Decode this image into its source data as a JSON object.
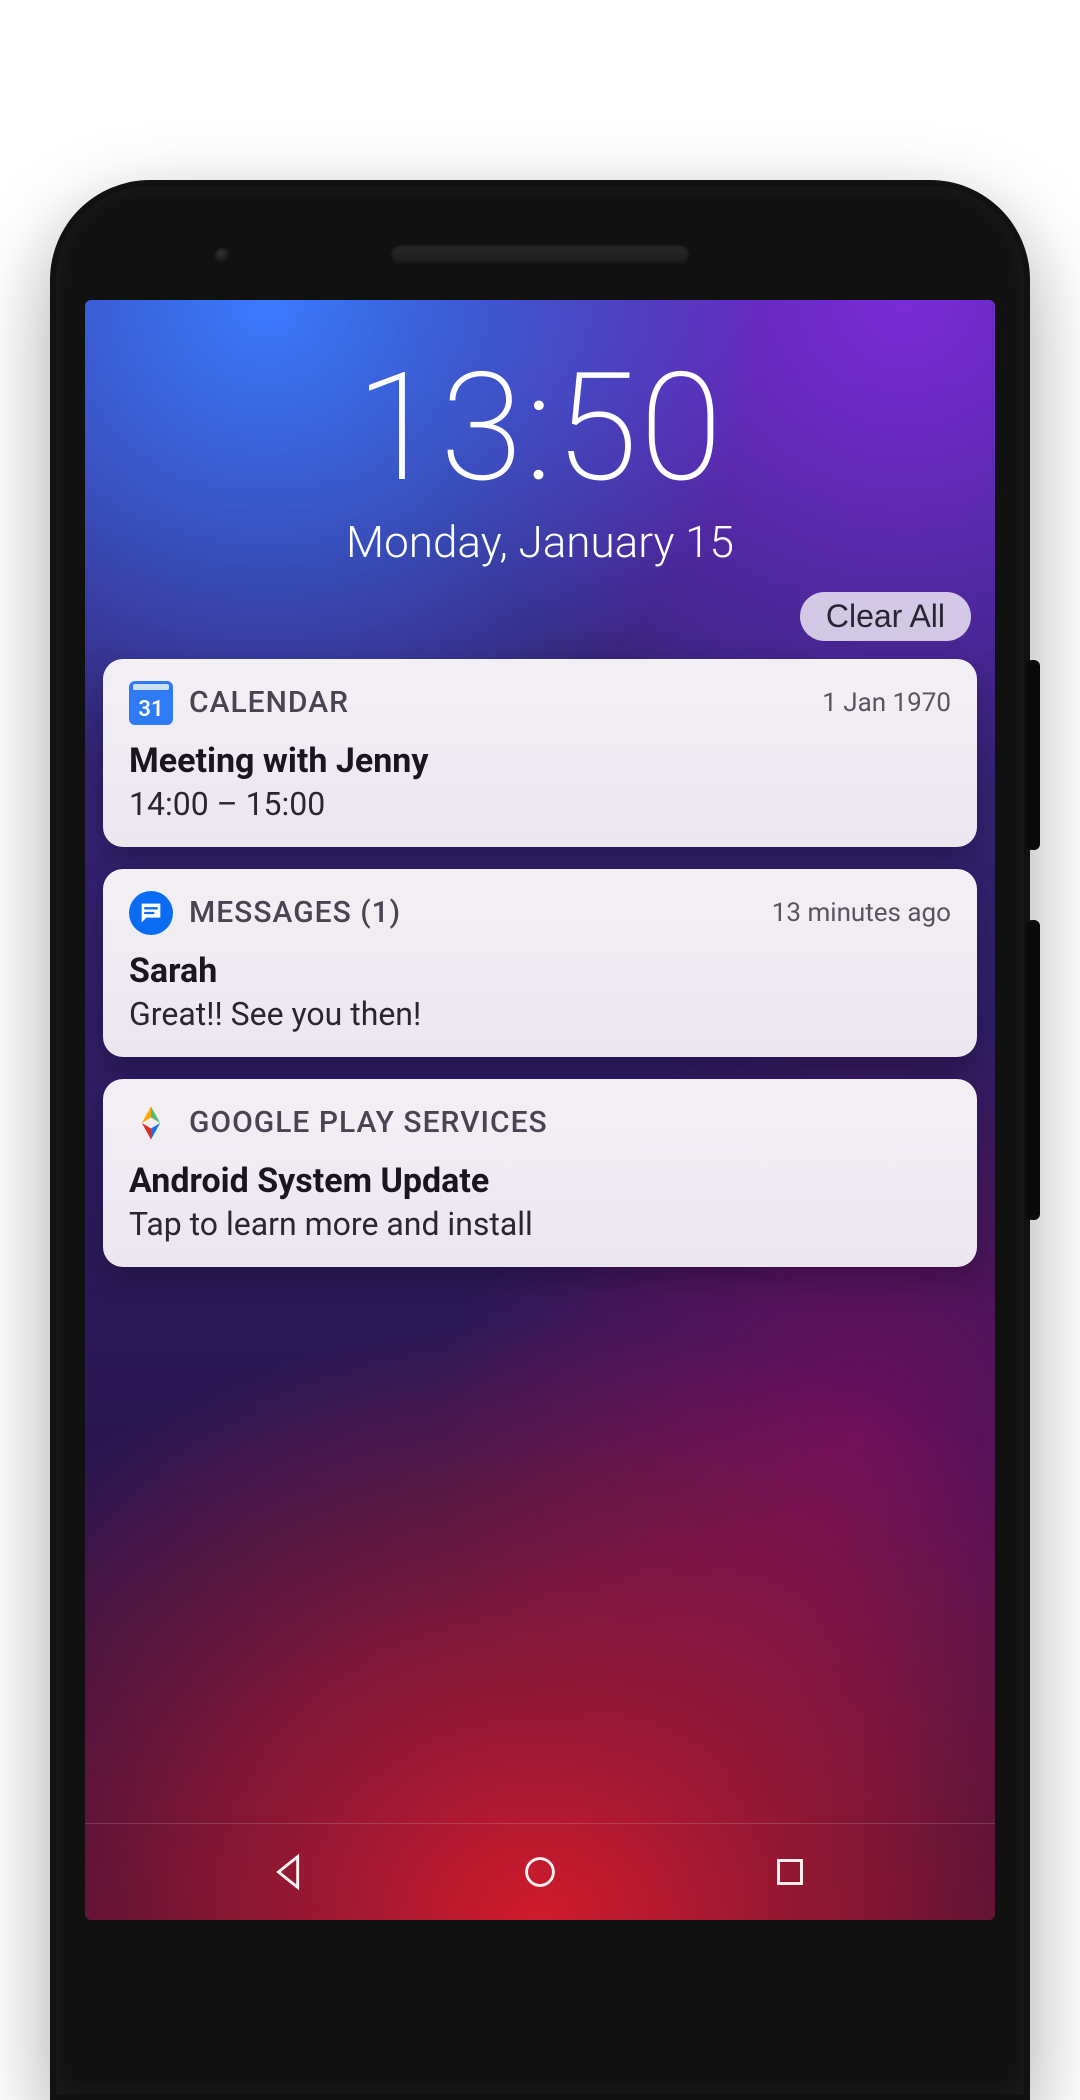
{
  "lock": {
    "time": "13:50",
    "date": "Monday, January 15",
    "clear_all": "Clear All"
  },
  "notifications": [
    {
      "icon": "calendar-icon",
      "icon_badge": "31",
      "app": "CALENDAR",
      "timestamp": "1 Jan 1970",
      "title": "Meeting with Jenny",
      "body": "14:00 – 15:00"
    },
    {
      "icon": "messages-icon",
      "app": "MESSAGES (1)",
      "timestamp": "13 minutes ago",
      "title": "Sarah",
      "body": "Great!! See you then!"
    },
    {
      "icon": "play-services-icon",
      "app": "GOOGLE PLAY SERVICES",
      "timestamp": "",
      "title": "Android System Update",
      "body": "Tap to learn more and install"
    }
  ]
}
